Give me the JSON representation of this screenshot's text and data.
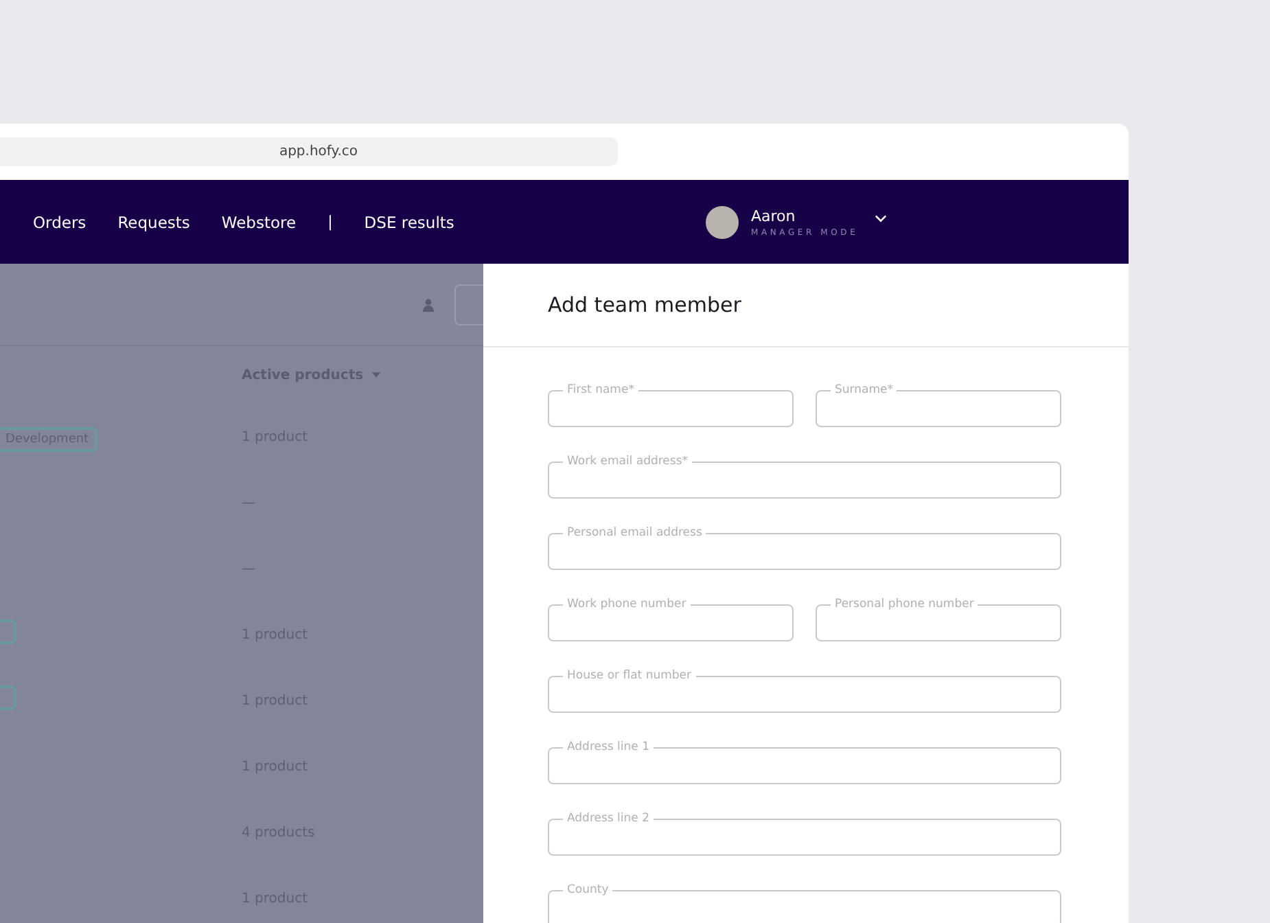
{
  "browser": {
    "url": "app.hofy.co"
  },
  "nav": {
    "items": [
      {
        "kind": "link",
        "label": "Orders"
      },
      {
        "kind": "link",
        "label": "Requests"
      },
      {
        "kind": "link",
        "label": "Webstore"
      },
      {
        "kind": "separator",
        "label": "|"
      },
      {
        "kind": "link",
        "label": "DSE results"
      }
    ],
    "user": {
      "name": "Aaron",
      "role": "MANAGER MODE"
    }
  },
  "background_table": {
    "column_header": "Active products",
    "rows": [
      {
        "kind": "tag",
        "tag_label": "Development",
        "products": "1 product"
      },
      {
        "kind": "plain",
        "products": "—"
      },
      {
        "kind": "plain",
        "products": "—"
      },
      {
        "kind": "tag_fragment",
        "products": "1 product"
      },
      {
        "kind": "tag_fragment",
        "products": "1 product"
      },
      {
        "kind": "plain",
        "products": "1 product"
      },
      {
        "kind": "plain",
        "products": "4 products"
      },
      {
        "kind": "plain",
        "products": "1 product"
      }
    ]
  },
  "drawer": {
    "title": "Add team member",
    "field_rows": [
      [
        {
          "label": "First name*"
        },
        {
          "label": "Surname*"
        }
      ],
      [
        {
          "label": "Work email address*"
        }
      ],
      [
        {
          "label": "Personal email address"
        }
      ],
      [
        {
          "label": "Work phone number"
        },
        {
          "label": "Personal phone number"
        }
      ],
      [
        {
          "label": "House or flat number"
        }
      ],
      [
        {
          "label": "Address line 1"
        }
      ],
      [
        {
          "label": "Address line 2"
        }
      ],
      [
        {
          "label": "County"
        }
      ]
    ]
  }
}
